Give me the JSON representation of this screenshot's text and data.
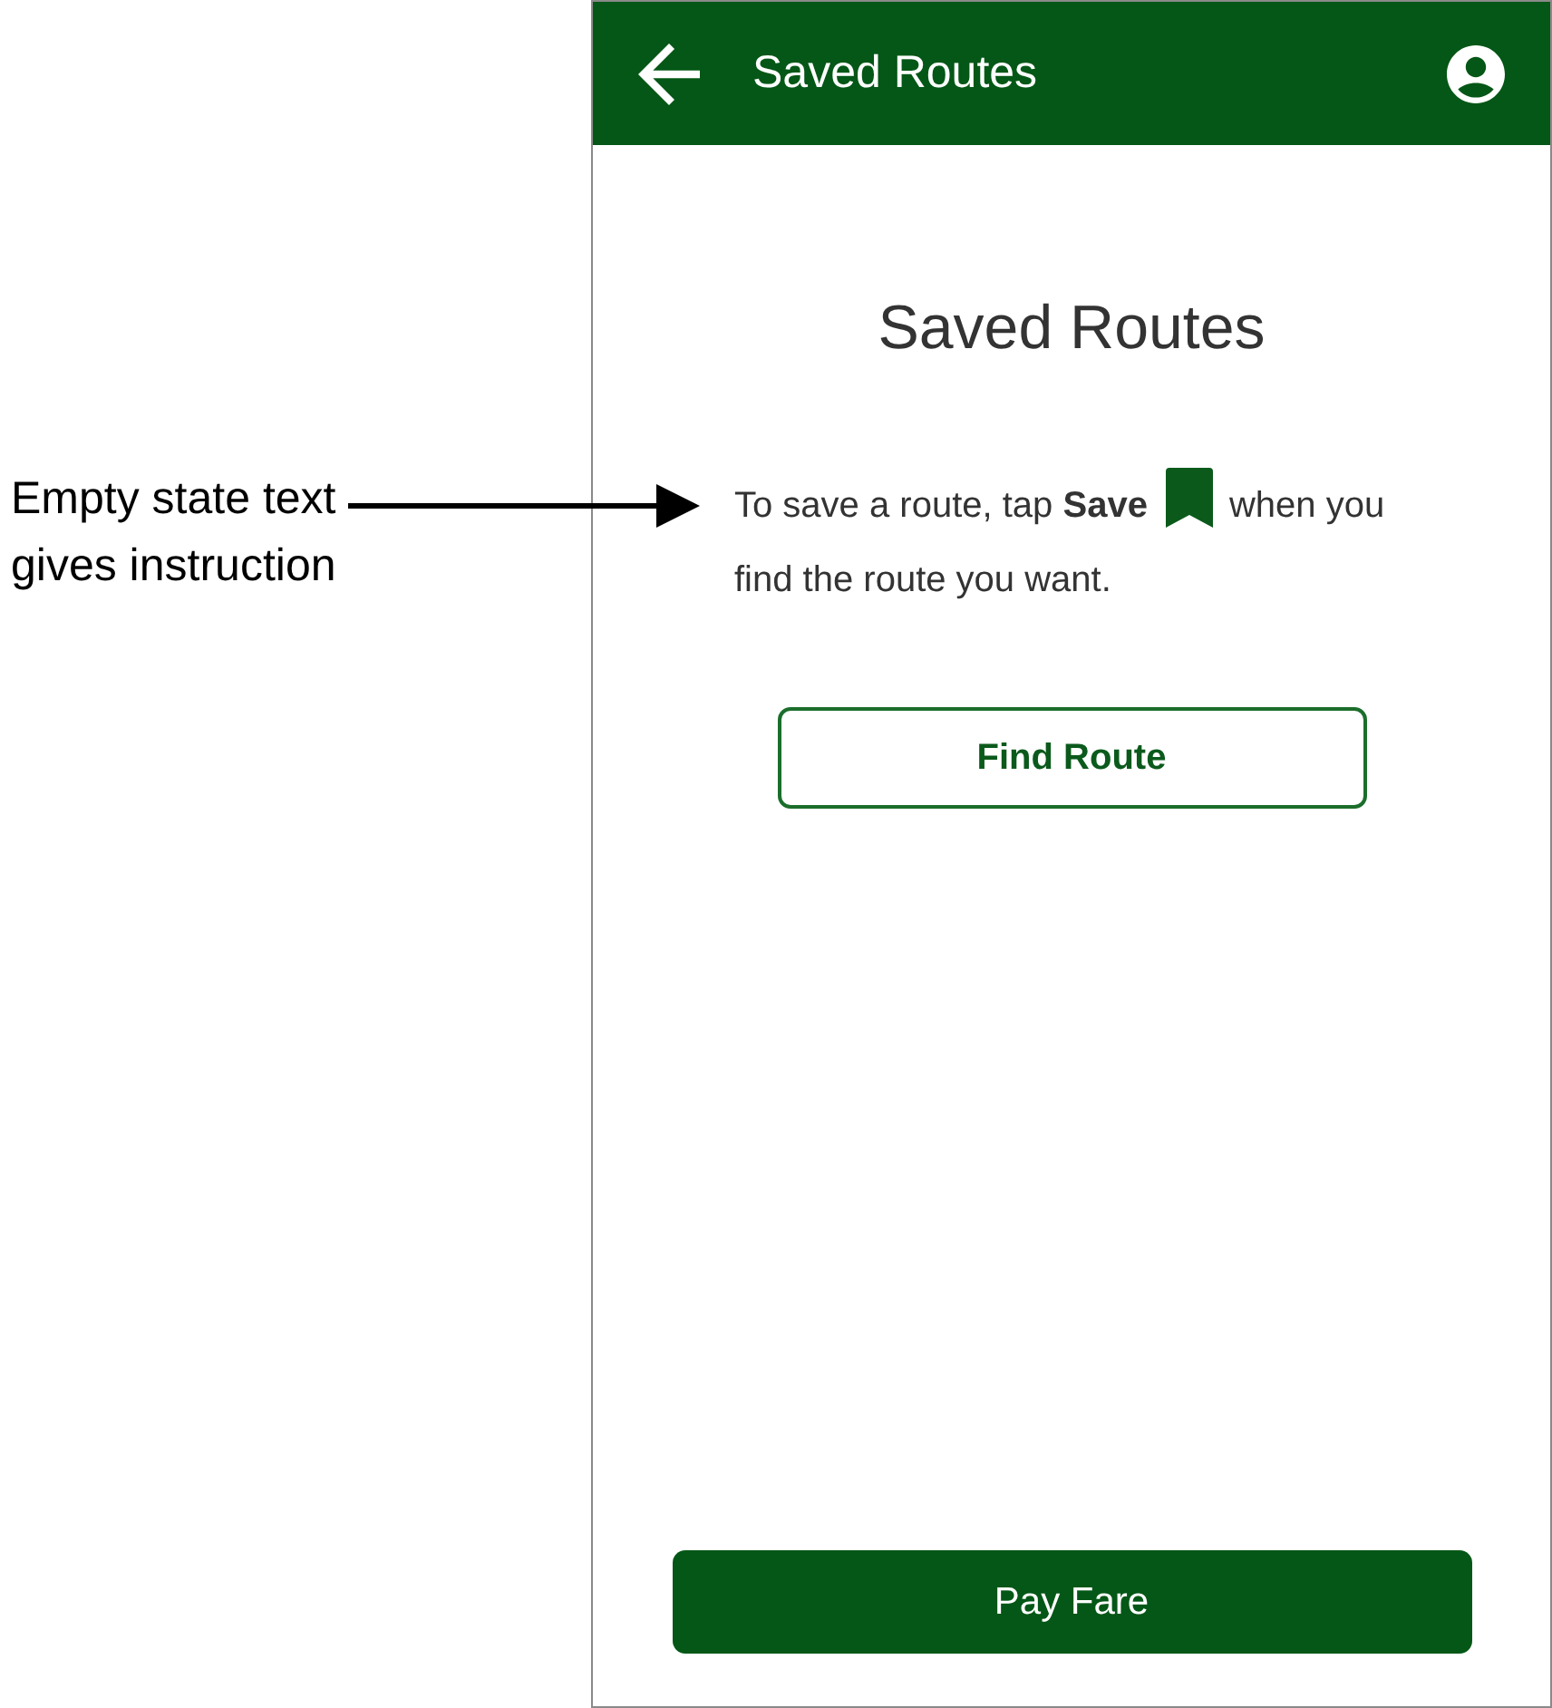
{
  "annotation": {
    "text": "Empty state text gives instruction"
  },
  "app_bar": {
    "title": "Saved Routes"
  },
  "empty_state": {
    "heading": "Saved Routes",
    "text_before_icon": "To save a route, tap **Save**",
    "text_after_icon": "when you find the route you want.",
    "action": {
      "label": "Find Route"
    }
  },
  "footer_button": {
    "label": "Pay Fare"
  }
}
